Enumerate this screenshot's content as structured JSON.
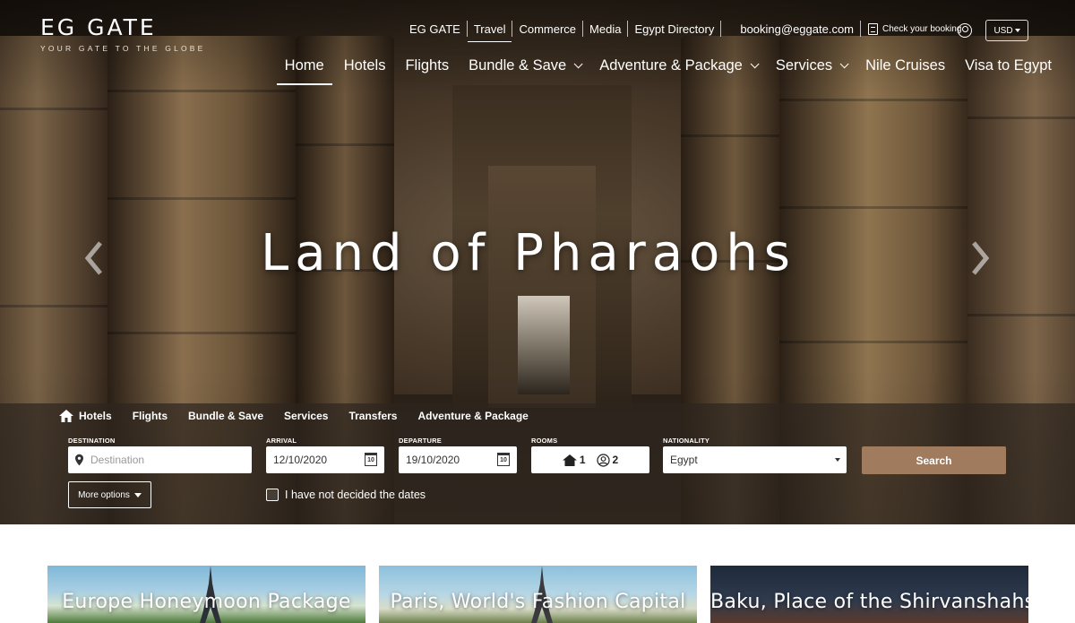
{
  "brand": {
    "name": "EG GATE",
    "tagline": "YOUR GATE TO THE GLOBE"
  },
  "top_nav": {
    "items": [
      "EG GATE",
      "Travel",
      "Commerce",
      "Media",
      "Egypt Directory"
    ],
    "active": "Travel",
    "email": "booking@eggate.com",
    "check_booking": "Check your booking",
    "currency": "USD"
  },
  "main_nav": {
    "items": [
      {
        "label": "Home",
        "dropdown": false
      },
      {
        "label": "Hotels",
        "dropdown": false
      },
      {
        "label": "Flights",
        "dropdown": false
      },
      {
        "label": "Bundle & Save",
        "dropdown": true
      },
      {
        "label": "Adventure & Package",
        "dropdown": true
      },
      {
        "label": "Services",
        "dropdown": true
      },
      {
        "label": "Nile Cruises",
        "dropdown": false
      },
      {
        "label": "Visa to Egypt",
        "dropdown": false
      }
    ],
    "active": "Home"
  },
  "hero": {
    "title": "Land of Pharaohs"
  },
  "search": {
    "tabs": [
      "Hotels",
      "Flights",
      "Bundle & Save",
      "Services",
      "Transfers",
      "Adventure & Package"
    ],
    "active_tab": "Hotels",
    "destination_label": "DESTINATION",
    "destination_placeholder": "Destination",
    "arrival_label": "ARRIVAL",
    "arrival_value": "12/10/2020",
    "departure_label": "DEPARTURE",
    "departure_value": "19/10/2020",
    "calendar_day": "10",
    "rooms_label": "ROOMS",
    "rooms_count": "1",
    "guests_count": "2",
    "nationality_label": "NATIONALITY",
    "nationality_value": "Egypt",
    "search_button": "Search",
    "more_options": "More options",
    "no_dates": "I have not decided the dates",
    "accent_color": "#a07b5e"
  },
  "cards": [
    {
      "title": "Europe Honeymoon Package"
    },
    {
      "title": "Paris, World's Fashion Capital"
    },
    {
      "title": "Baku, Place of the Shirvanshahs!"
    }
  ]
}
